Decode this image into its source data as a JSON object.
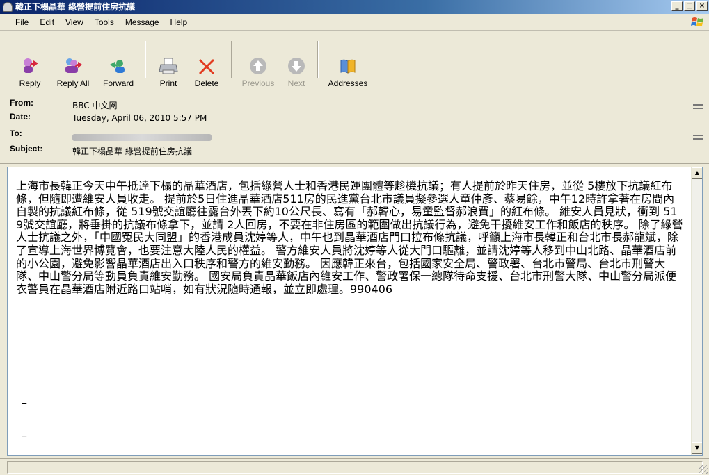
{
  "window": {
    "title": "韓正下榻晶華 綠營提前住房抗議",
    "minimize": "_",
    "maximize": "□",
    "close": "×"
  },
  "menu": [
    "File",
    "Edit",
    "View",
    "Tools",
    "Message",
    "Help"
  ],
  "toolbar": {
    "reply": "Reply",
    "reply_all": "Reply All",
    "forward": "Forward",
    "print": "Print",
    "delete": "Delete",
    "previous": "Previous",
    "next": "Next",
    "addresses": "Addresses"
  },
  "headers": {
    "from_label": "From:",
    "from_value": "BBC 中文网",
    "date_label": "Date:",
    "date_value": "Tuesday, April 06, 2010 5:57 PM",
    "to_label": "To:",
    "to_value": "",
    "subject_label": "Subject:",
    "subject_value": "韓正下榻晶華 綠營提前住房抗議"
  },
  "message": {
    "body": "上海市長韓正今天中午抵達下榻的晶華酒店，包括綠營人士和香港民運團體等趁機抗議；有人提前於昨天住房，並從 5樓放下抗議紅布條，但隨即遭維安人員收走。 提前於5日住進晶華酒店511房的民進黨台北市議員擬參選人童仲彥、蔡易餘，中午12時許拿著在房間內自製的抗議紅布條，從 519號交誼廳往露台外丟下約10公尺長、寫有「郝韓心，易童監督郝浪費」的紅布條。 維安人員見狀，衝到 519號交誼廳，將垂掛的抗議布條拿下，並請 2人回房，不要在非住房區的範圍做出抗議行為，避免干擾維安工作和飯店的秩序。 除了綠營人士抗議之外，「中國冤民大同盟」的香港成員沈婷等人，中午也到晶華酒店門口拉布條抗議，呼籲上海市長韓正和台北市長郝龍斌，除了宣導上海世界博覽會，也要注意大陸人民的權益。 警方維安人員將沈婷等人從大門口驅離，並請沈婷等人移到中山北路、晶華酒店前的小公園，避免影響晶華酒店出入口秩序和警方的維安勤務。 因應韓正來台，包括國家安全局、警政署、台北市警局、台北市刑警大隊、中山警分局等動員負責維安勤務。 國安局負責晶華飯店內維安工作、警政署保一總隊待命支援、台北市刑警大隊、中山警分局派便衣警員在晶華酒店附近路口站哨，如有狀況隨時通報，並立即處理。990406",
    "dash1": "–",
    "dash2": "–"
  },
  "colors": {
    "title_bar": "#0a246a",
    "window_bg": "#ece9d8",
    "delete_red": "#e23b20"
  }
}
